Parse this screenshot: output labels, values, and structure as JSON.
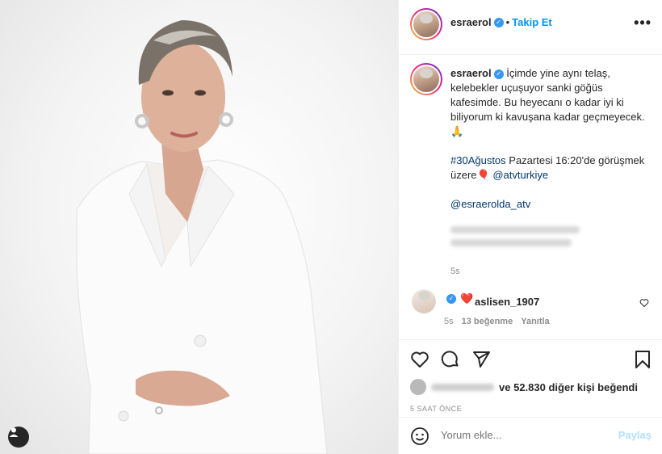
{
  "header": {
    "username": "esraerol",
    "separator": "•",
    "follow_label": "Takip Et",
    "more_label": "•••"
  },
  "caption": {
    "username": "esraerol",
    "line1": "İçimde yine aynı telaş, kelebekler uçuşuyor sanki göğüs kafesimde. Bu heyecanı o kadar iyi ki biliyorum ki kavuşana kadar geçmeyecek.🙏",
    "line2_tag": "#30Ağustos",
    "line2_text": " Pazartesi 16:20'de görüşmek üzere🎈 ",
    "line2_mention": "@atvturkiye",
    "mention2": "@esraerolda_atv",
    "time": "5s"
  },
  "comment": {
    "username": "aslisen_1907",
    "text": "❤️",
    "time": "5s",
    "likes": "13 beğenme",
    "reply": "Yanıtla"
  },
  "likes": {
    "count": "52.830",
    "text": " diğer kişi beğendi"
  },
  "time_ago": "5 SAAT ÖNCE",
  "comment_input": {
    "placeholder": "Yorum ekle..."
  },
  "post_label": "Paylaş",
  "colors": {
    "accent": "#0095f6",
    "link": "#00376b",
    "muted": "#8e8e8e",
    "heart": "#ed4956"
  },
  "icons": [
    "verified-icon",
    "more-icon",
    "heart-icon",
    "comment-icon",
    "share-icon",
    "bookmark-icon",
    "smile-icon",
    "user-tag-icon"
  ]
}
